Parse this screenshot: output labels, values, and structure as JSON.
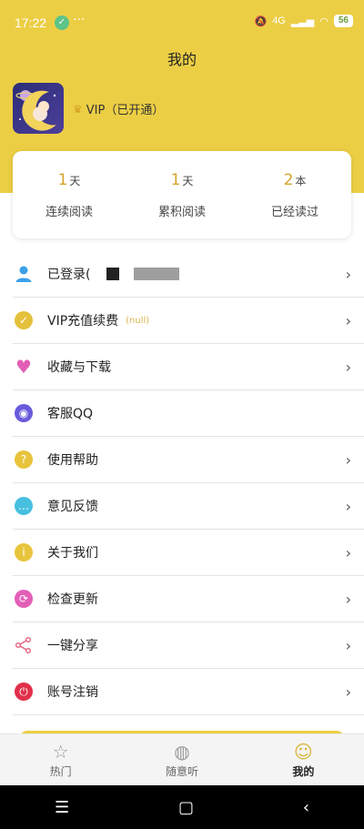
{
  "status_bar": {
    "time": "17:22",
    "dots": "···",
    "network": "4G",
    "battery": "56"
  },
  "page": {
    "title": "我的"
  },
  "profile": {
    "vip_text": "VIP（已开通）"
  },
  "stats": [
    {
      "value": "1",
      "unit": "天",
      "label": "连续阅读"
    },
    {
      "value": "1",
      "unit": "天",
      "label": "累积阅读"
    },
    {
      "value": "2",
      "unit": "本",
      "label": "已经读过"
    }
  ],
  "menu": [
    {
      "label": "已登录(",
      "icon": "user-icon",
      "color": "#3aa0e8"
    },
    {
      "label": "VIP充值续费",
      "note": "(null)",
      "icon": "vip-icon",
      "color": "#e4c13c"
    },
    {
      "label": "收藏与下载",
      "icon": "heart-icon",
      "color": "#e35fb7"
    },
    {
      "label": "客服QQ",
      "icon": "qq-icon",
      "color": "#6a5bdc"
    },
    {
      "label": "使用帮助",
      "icon": "help-icon",
      "color": "#e8c43c"
    },
    {
      "label": "意见反馈",
      "icon": "feedback-icon",
      "color": "#47c0df"
    },
    {
      "label": "关于我们",
      "icon": "info-icon",
      "color": "#e8c43c"
    },
    {
      "label": "检查更新",
      "icon": "refresh-icon",
      "color": "#e35fb7"
    },
    {
      "label": "一键分享",
      "icon": "share-icon",
      "color": "#e35f7a"
    },
    {
      "label": "账号注销",
      "icon": "power-icon",
      "color": "#e0304a"
    }
  ],
  "tabs": [
    {
      "label": "热门",
      "icon": "star-icon"
    },
    {
      "label": "随意听",
      "icon": "planet-icon"
    },
    {
      "label": "我的",
      "icon": "smile-icon",
      "active": true
    }
  ],
  "colors": {
    "accent": "#ecce45",
    "stat_value": "#d6a42b"
  }
}
